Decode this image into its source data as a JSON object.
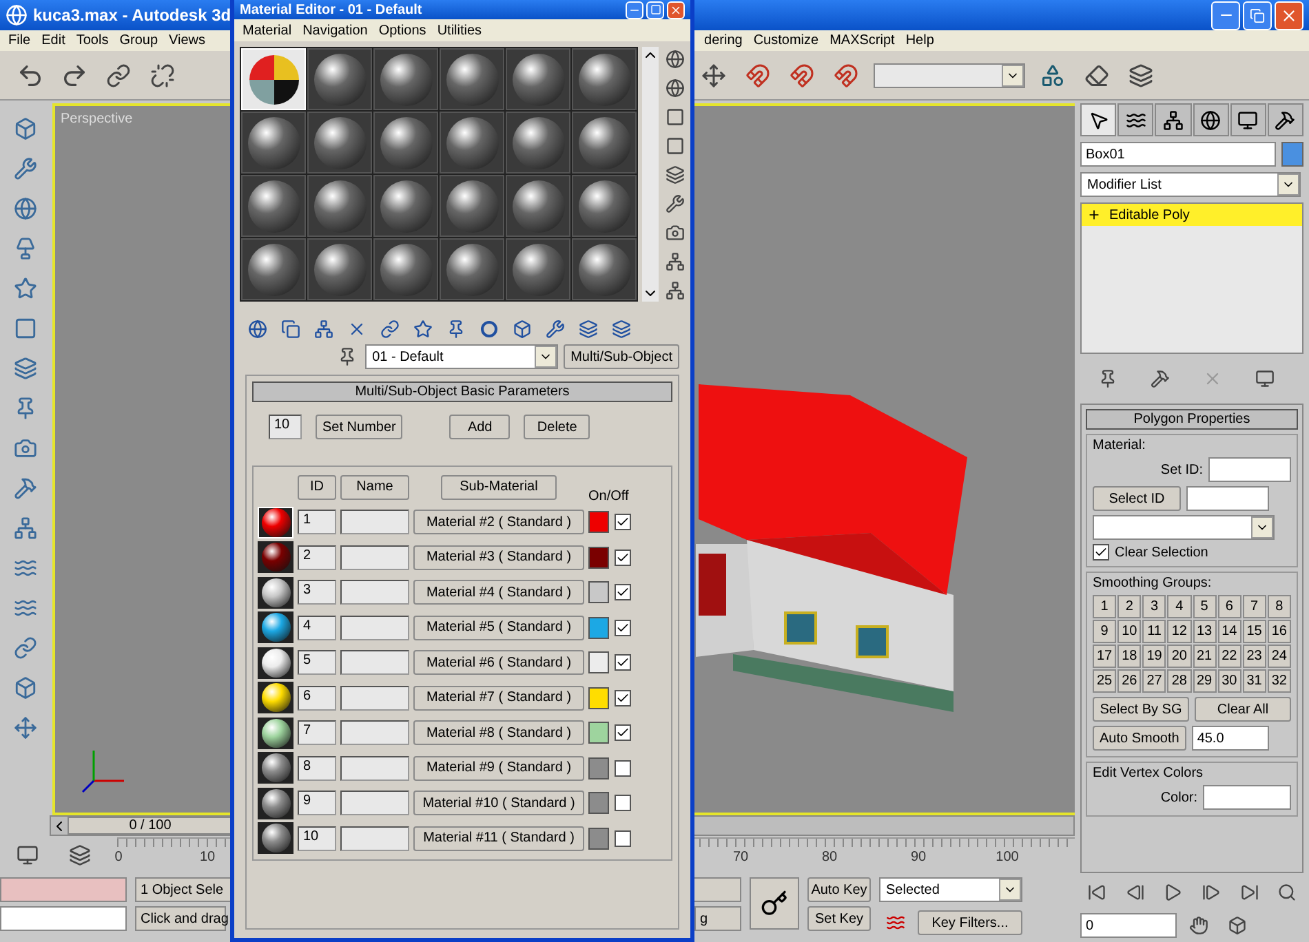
{
  "app": {
    "title": "kuca3.max - Autodesk 3d",
    "menu": [
      "File",
      "Edit",
      "Tools",
      "Group",
      "Views",
      "dering",
      "Customize",
      "MAXScript",
      "Help"
    ]
  },
  "viewport": {
    "label": "Perspective"
  },
  "command_panel": {
    "tabs": [
      {
        "selected": true
      },
      {
        "selected": false
      },
      {
        "selected": false
      },
      {
        "selected": false
      },
      {
        "selected": false
      },
      {
        "selected": false
      }
    ],
    "object_name": "Box01",
    "modifier_list": "Modifier List",
    "stack": [
      {
        "label": "Editable Poly",
        "selected": true
      }
    ],
    "rollout": "Polygon Properties",
    "material_group": "Material:",
    "set_id": "Set ID:",
    "select_id": "Select ID",
    "clear_selection": {
      "label": "Clear Selection",
      "checked": true
    },
    "smoothing_title": "Smoothing Groups:",
    "smoothing": [
      "1",
      "2",
      "3",
      "4",
      "5",
      "6",
      "7",
      "8",
      "9",
      "10",
      "11",
      "12",
      "13",
      "14",
      "15",
      "16",
      "17",
      "18",
      "19",
      "20",
      "21",
      "22",
      "23",
      "24",
      "25",
      "26",
      "27",
      "28",
      "29",
      "30",
      "31",
      "32"
    ],
    "select_by_sg": "Select By SG",
    "clear_all": "Clear All",
    "auto_smooth": "Auto Smooth",
    "threshold": "45.0",
    "vertex_colors": "Edit Vertex Colors",
    "color_label": "Color:"
  },
  "timeline": {
    "slider": "0 / 100",
    "level": 0,
    "marks": [
      "0",
      "10",
      "70",
      "80",
      "90",
      "100"
    ]
  },
  "status": {
    "selection": "1 Object Sele",
    "prompt": "Click and drag",
    "prompt_tail": "g",
    "auto_key": "Auto Key",
    "set_key": "Set Key",
    "key_mode": "Selected",
    "key_filters": "Key Filters...",
    "frame": "0"
  },
  "editor": {
    "title": "Material Editor - 01 - Default",
    "menu": [
      "Material",
      "Navigation",
      "Options",
      "Utilities"
    ],
    "slots": [
      {
        "kind": "multi",
        "selected": true
      },
      {
        "kind": "standard",
        "selected": false
      },
      {
        "kind": "standard",
        "selected": false
      },
      {
        "kind": "standard",
        "selected": false
      },
      {
        "kind": "standard",
        "selected": false
      },
      {
        "kind": "standard",
        "selected": false
      },
      {
        "kind": "standard",
        "selected": false
      },
      {
        "kind": "standard",
        "selected": false
      },
      {
        "kind": "standard",
        "selected": false
      },
      {
        "kind": "standard",
        "selected": false
      },
      {
        "kind": "standard",
        "selected": false
      },
      {
        "kind": "standard",
        "selected": false
      },
      {
        "kind": "standard",
        "selected": false
      },
      {
        "kind": "standard",
        "selected": false
      },
      {
        "kind": "standard",
        "selected": false
      },
      {
        "kind": "standard",
        "selected": false
      },
      {
        "kind": "standard",
        "selected": false
      },
      {
        "kind": "standard",
        "selected": false
      },
      {
        "kind": "standard",
        "selected": false
      },
      {
        "kind": "standard",
        "selected": false
      },
      {
        "kind": "standard",
        "selected": false
      },
      {
        "kind": "standard",
        "selected": false
      },
      {
        "kind": "standard",
        "selected": false
      },
      {
        "kind": "standard",
        "selected": false
      }
    ],
    "material_name": "01 - Default",
    "material_type": "Multi/Sub-Object",
    "rollout": "Multi/Sub-Object Basic Parameters",
    "count": "10",
    "set_number": "Set Number",
    "add": "Add",
    "delete": "Delete",
    "columns": [
      "ID",
      "Name",
      "Sub-Material",
      "On/Off"
    ],
    "rows": [
      {
        "id": "1",
        "material": "Material #2 ( Standard )",
        "color": "#ee0000",
        "on": true,
        "selected": true
      },
      {
        "id": "2",
        "material": "Material #3 ( Standard )",
        "color": "#7a0000",
        "on": true,
        "selected": false
      },
      {
        "id": "3",
        "material": "Material #4 ( Standard )",
        "color": "#c8c8c8",
        "on": true,
        "selected": false
      },
      {
        "id": "4",
        "material": "Material #5 ( Standard )",
        "color": "#1ca8e4",
        "on": true,
        "selected": false
      },
      {
        "id": "5",
        "material": "Material #6 ( Standard )",
        "color": "#ececec",
        "on": true,
        "selected": false
      },
      {
        "id": "6",
        "material": "Material #7 ( Standard )",
        "color": "#ffdd00",
        "on": true,
        "selected": false
      },
      {
        "id": "7",
        "material": "Material #8 ( Standard )",
        "color": "#9ed49e",
        "on": true,
        "selected": false
      },
      {
        "id": "8",
        "material": "Material #9 ( Standard )",
        "color": "#8c8c8c",
        "on": false,
        "selected": false
      },
      {
        "id": "9",
        "material": "Material #10 ( Standard )",
        "color": "#8c8c8c",
        "on": false,
        "selected": false
      },
      {
        "id": "10",
        "material": "Material #11 ( Standard )",
        "color": "#8c8c8c",
        "on": false,
        "selected": false
      }
    ]
  }
}
